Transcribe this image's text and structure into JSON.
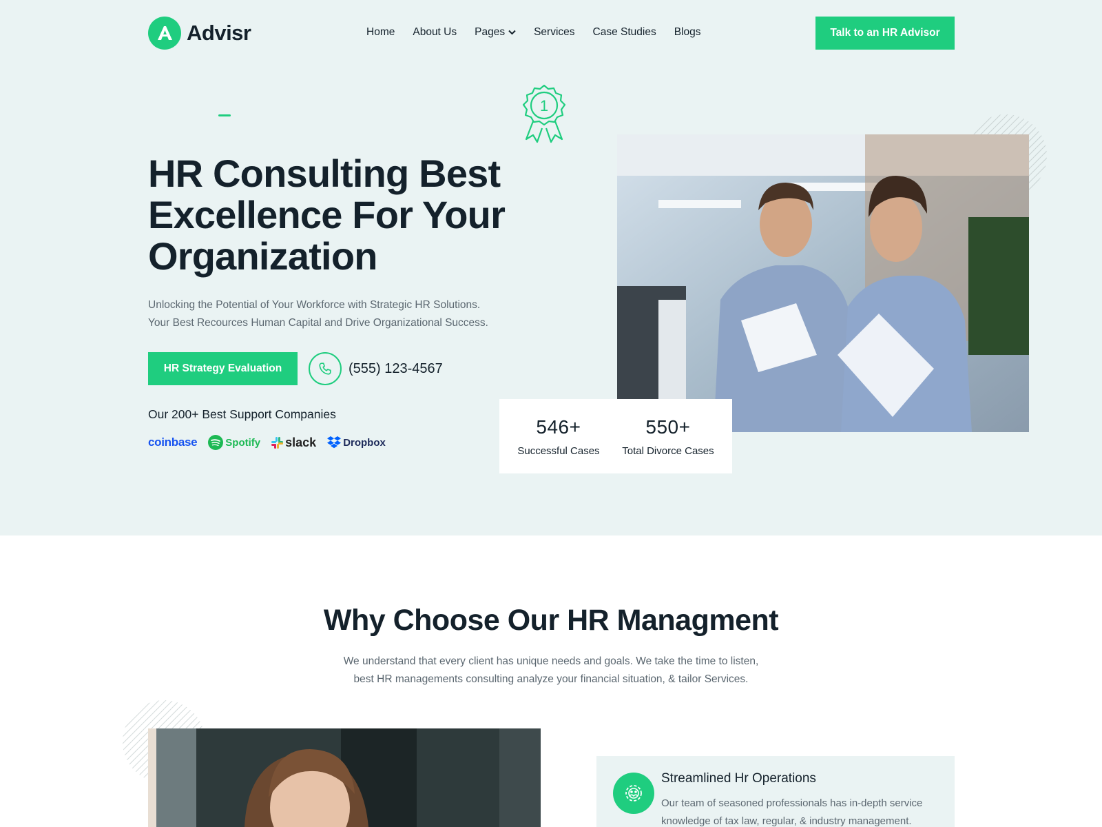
{
  "brand": {
    "name": "Advisr",
    "accent_color": "#1fcd7f"
  },
  "nav": {
    "items": [
      {
        "label": "Home"
      },
      {
        "label": "About Us"
      },
      {
        "label": "Pages",
        "has_dropdown": true
      },
      {
        "label": "Services"
      },
      {
        "label": "Case Studies"
      },
      {
        "label": "Blogs"
      }
    ],
    "cta_label": "Talk to an HR Advisor"
  },
  "hero": {
    "award_icon": "award-ribbon-1",
    "title": "HR Consulting Best Excellence For Your Organization",
    "description_lines": [
      "Unlocking the Potential of Your Workforce with Strategic HR Solutions.",
      "Your Best Recources Human Capital and Drive Organizational Success."
    ],
    "primary_button": "HR Strategy Evaluation",
    "phone": "(555) 123-4567",
    "phone_icon": "phone-icon",
    "support_title": "Our 200+ Best Support Companies",
    "brands": [
      "coinbase",
      "Spotify",
      "slack",
      "Dropbox"
    ],
    "image_alt": "two-businessmen-reviewing-documents"
  },
  "stats": [
    {
      "value": "546+",
      "label": "Successful Cases"
    },
    {
      "value": "550+",
      "label": "Total Divorce Cases"
    }
  ],
  "why": {
    "title": "Why Choose Our HR Managment",
    "description_lines": [
      "We understand that every client has unique needs and goals. We take the time to listen,",
      "best HR managements consulting analyze your financial situation, & tailor Services."
    ],
    "image_alt": "smiling-woman-at-office",
    "feature": {
      "icon": "gear-users-icon",
      "title": "Streamlined Hr Operations",
      "description": "Our team of seasoned professionals has in-depth service knowledge of tax law, regular, & industry management."
    }
  }
}
